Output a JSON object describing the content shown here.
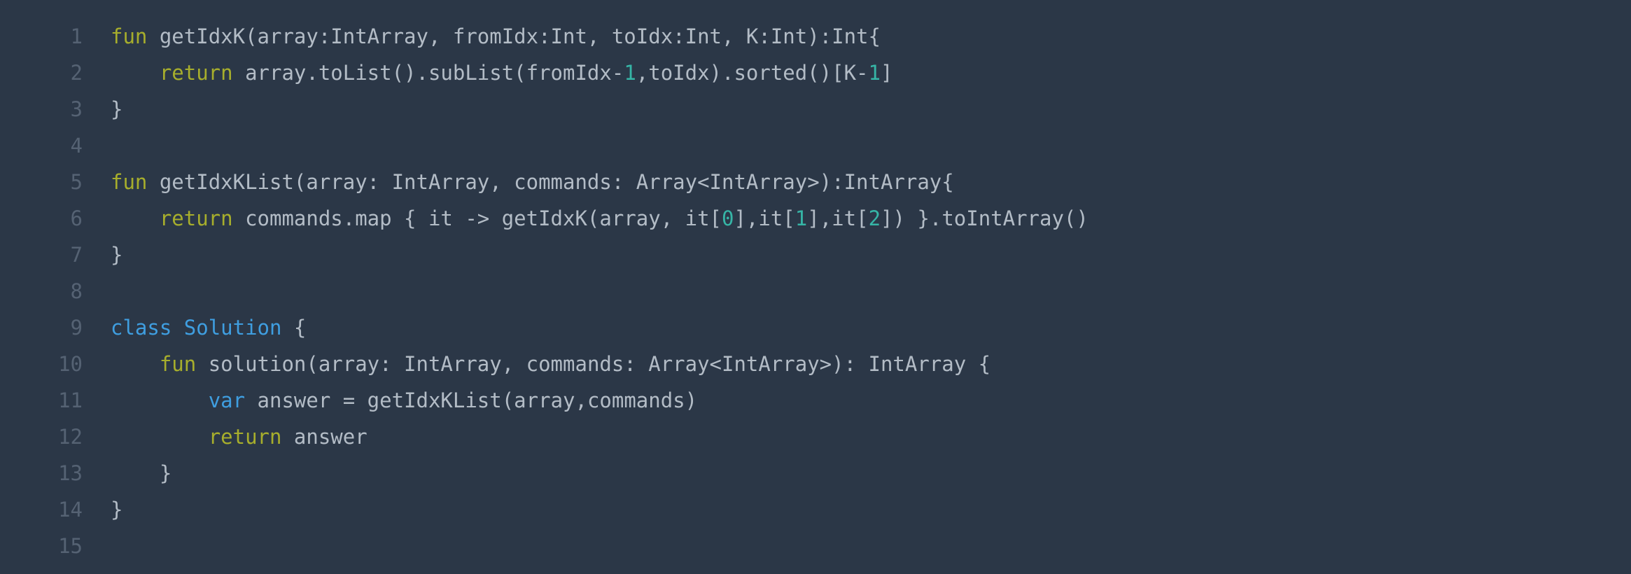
{
  "colors": {
    "background": "#2b3747",
    "line_number": "#556273",
    "text": "#b3bcc6",
    "keyword": "#a7ae2c",
    "declaration_keyword": "#3f9ee0",
    "number": "#36b5a6"
  },
  "lines": [
    {
      "number": "1",
      "tokens": [
        {
          "type": "kw",
          "text": "fun"
        },
        {
          "type": "txt",
          "text": " getIdxK(array:IntArray, fromIdx:Int, toIdx:Int, K:Int):Int{"
        }
      ]
    },
    {
      "number": "2",
      "tokens": [
        {
          "type": "txt",
          "text": "    "
        },
        {
          "type": "kw",
          "text": "return"
        },
        {
          "type": "txt",
          "text": " array.toList().subList(fromIdx-"
        },
        {
          "type": "num",
          "text": "1"
        },
        {
          "type": "txt",
          "text": ",toIdx).sorted()[K-"
        },
        {
          "type": "num",
          "text": "1"
        },
        {
          "type": "txt",
          "text": "]"
        }
      ]
    },
    {
      "number": "3",
      "tokens": [
        {
          "type": "txt",
          "text": "}"
        }
      ]
    },
    {
      "number": "4",
      "tokens": []
    },
    {
      "number": "5",
      "tokens": [
        {
          "type": "kw",
          "text": "fun"
        },
        {
          "type": "txt",
          "text": " getIdxKList(array: IntArray, commands: Array<IntArray>):IntArray{"
        }
      ]
    },
    {
      "number": "6",
      "tokens": [
        {
          "type": "txt",
          "text": "    "
        },
        {
          "type": "kw",
          "text": "return"
        },
        {
          "type": "txt",
          "text": " commands.map { it -> getIdxK(array, it["
        },
        {
          "type": "num",
          "text": "0"
        },
        {
          "type": "txt",
          "text": "],it["
        },
        {
          "type": "num",
          "text": "1"
        },
        {
          "type": "txt",
          "text": "],it["
        },
        {
          "type": "num",
          "text": "2"
        },
        {
          "type": "txt",
          "text": "]) }.toIntArray()"
        }
      ]
    },
    {
      "number": "7",
      "tokens": [
        {
          "type": "txt",
          "text": "}"
        }
      ]
    },
    {
      "number": "8",
      "tokens": []
    },
    {
      "number": "9",
      "tokens": [
        {
          "type": "kw2",
          "text": "class"
        },
        {
          "type": "txt",
          "text": " "
        },
        {
          "type": "kw2",
          "text": "Solution"
        },
        {
          "type": "txt",
          "text": " {"
        }
      ]
    },
    {
      "number": "10",
      "tokens": [
        {
          "type": "txt",
          "text": "    "
        },
        {
          "type": "kw",
          "text": "fun"
        },
        {
          "type": "txt",
          "text": " solution(array: IntArray, commands: Array<IntArray>): IntArray {"
        }
      ]
    },
    {
      "number": "11",
      "tokens": [
        {
          "type": "txt",
          "text": "        "
        },
        {
          "type": "kw2",
          "text": "var"
        },
        {
          "type": "txt",
          "text": " answer = getIdxKList(array,commands)"
        }
      ]
    },
    {
      "number": "12",
      "tokens": [
        {
          "type": "txt",
          "text": "        "
        },
        {
          "type": "kw",
          "text": "return"
        },
        {
          "type": "txt",
          "text": " answer"
        }
      ]
    },
    {
      "number": "13",
      "tokens": [
        {
          "type": "txt",
          "text": "    }"
        }
      ]
    },
    {
      "number": "14",
      "tokens": [
        {
          "type": "txt",
          "text": "}"
        }
      ]
    },
    {
      "number": "15",
      "tokens": []
    }
  ]
}
